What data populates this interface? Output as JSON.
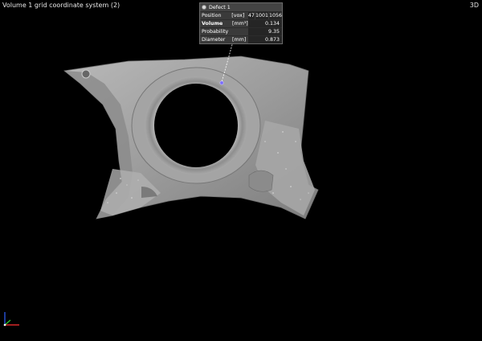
{
  "viewport": {
    "title": "Volume 1 grid coordinate system (2)",
    "mode": "3D"
  },
  "defect_popup": {
    "title": "Defect 1",
    "rows": {
      "position": {
        "label": "Position",
        "unit": "[vox]",
        "values": [
          "47",
          "1001",
          "1056"
        ]
      },
      "volume": {
        "label": "Volume",
        "unit": "[mm³]",
        "value": "0.134"
      },
      "probability": {
        "label": "Probability",
        "unit": "",
        "value": "9.35"
      },
      "diameter": {
        "label": "Diameter",
        "unit": "[mm]",
        "value": "0.873"
      }
    }
  },
  "colors": {
    "background": "#000000",
    "model": "#9a9a9a",
    "defect_marker": "#7a6cff",
    "axis_x": "#ff3030",
    "axis_y": "#30d030",
    "axis_z": "#3060ff"
  },
  "icons": {
    "defect": "defect-icon",
    "axes": "orientation-axes-icon"
  }
}
